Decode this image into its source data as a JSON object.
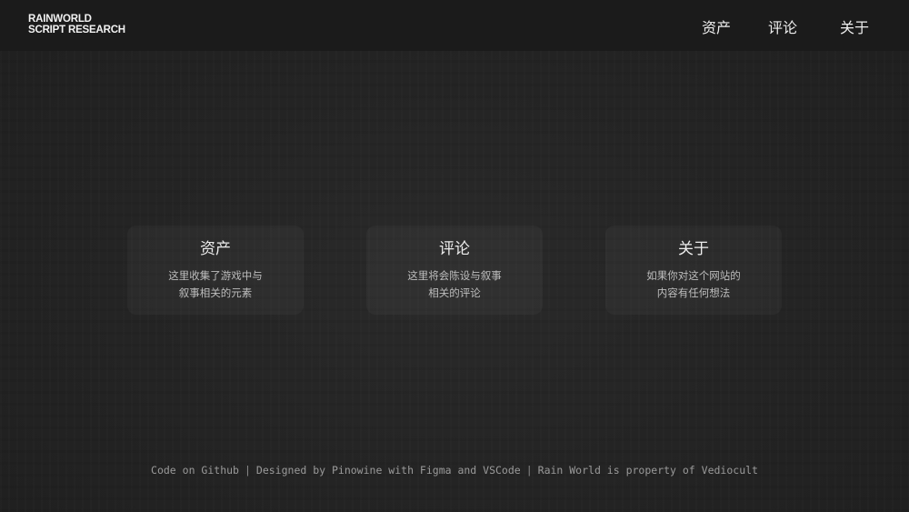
{
  "header": {
    "logo_line1": "RAINWORLD",
    "logo_line2": "SCRIPT RESEARCH",
    "nav": [
      {
        "label": "资产"
      },
      {
        "label": "评论"
      },
      {
        "label": "关于"
      }
    ]
  },
  "cards": [
    {
      "title": "资产",
      "desc_line1": "这里收集了游戏中与",
      "desc_line2": "叙事相关的元素"
    },
    {
      "title": "评论",
      "desc_line1": "这里将会陈设与叙事",
      "desc_line2": "相关的评论"
    },
    {
      "title": "关于",
      "desc_line1": "如果你对这个网站的",
      "desc_line2": "内容有任何想法"
    }
  ],
  "footer": {
    "github": "Code on Github",
    "separator": "|",
    "designed": "Designed by Pinowine with Figma and VSCode",
    "property": "Rain World is property of Vediocult"
  },
  "colors": {
    "background": "#242424",
    "header": "#1b1b1b",
    "text": "#e6e6e6",
    "muted": "#9a9a9a"
  }
}
